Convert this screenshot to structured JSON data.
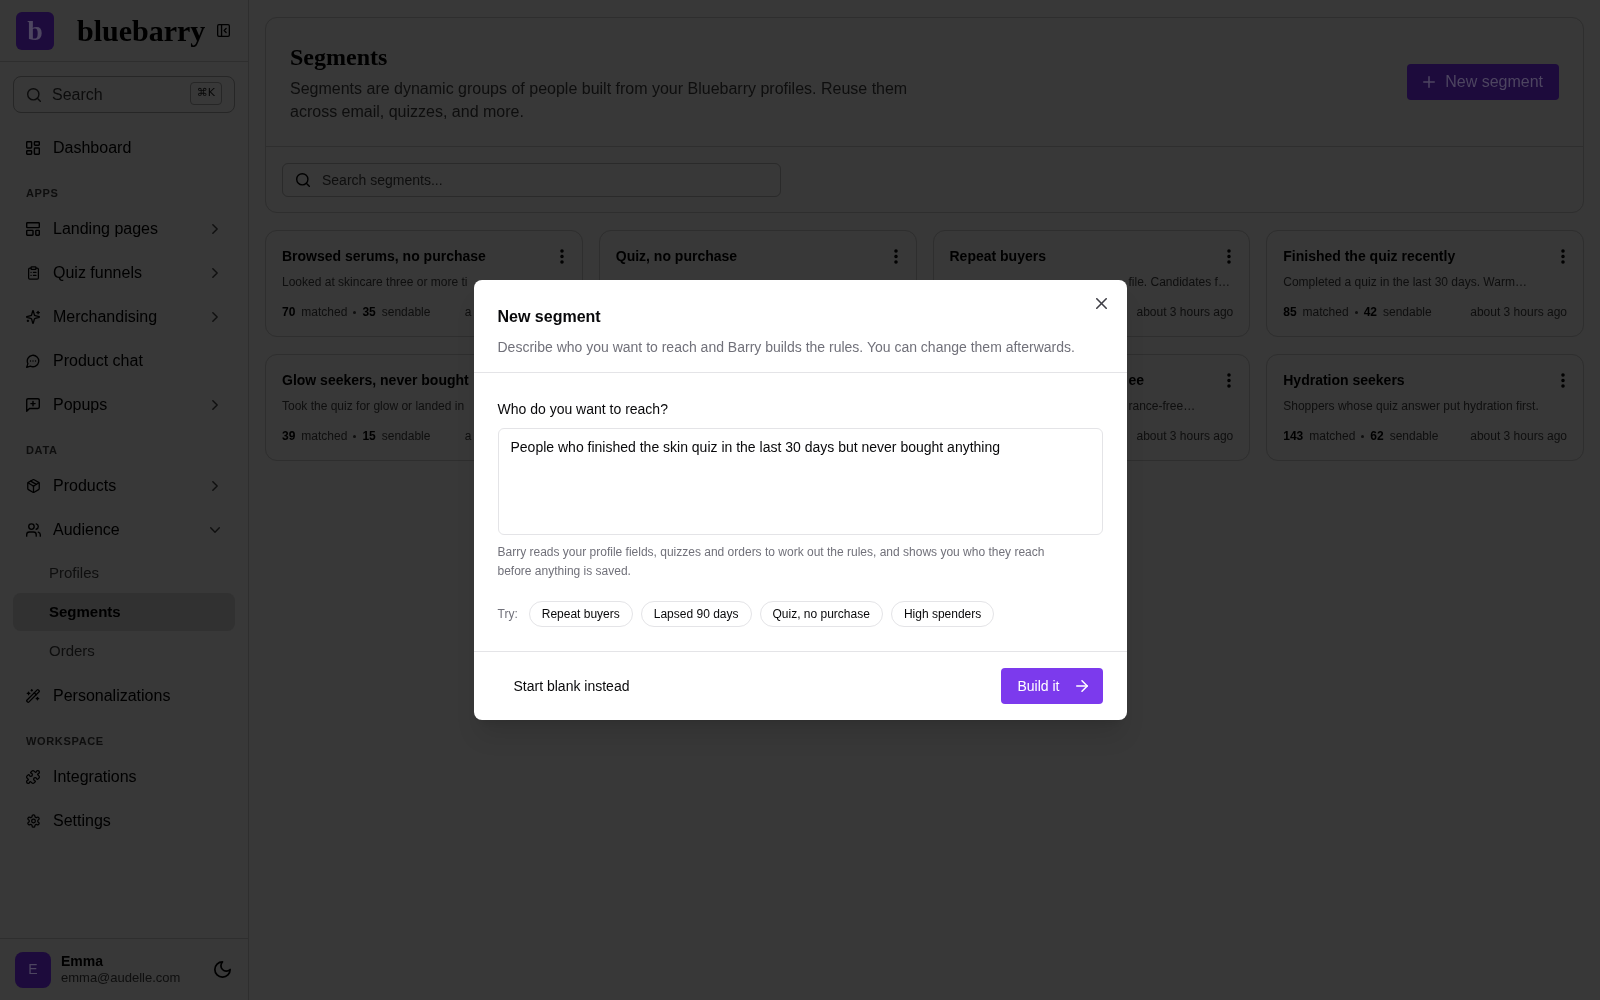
{
  "sidebar": {
    "logo": {
      "mark": "b",
      "name": "bluebarry"
    },
    "search": {
      "placeholder": "Search",
      "shortcut": "⌘K"
    },
    "sections": [
      {
        "items": [
          {
            "label": "Dashboard",
            "selected": false
          }
        ]
      },
      {
        "heading": "APPS",
        "items": [
          {
            "label": "Landing pages",
            "selected": false,
            "expanded": false
          },
          {
            "label": "Quiz funnels",
            "selected": false,
            "expanded": false
          },
          {
            "label": "Merchandising",
            "selected": false,
            "expanded": false
          },
          {
            "label": "Product chat",
            "selected": false
          },
          {
            "label": "Popups",
            "selected": false,
            "expanded": false
          }
        ]
      },
      {
        "heading": "DATA",
        "items": [
          {
            "label": "Products",
            "selected": false,
            "expanded": false
          },
          {
            "label": "Audience",
            "selected": false,
            "expanded": true,
            "children": [
              {
                "label": "Profiles",
                "selected": false
              },
              {
                "label": "Segments",
                "selected": true
              },
              {
                "label": "Orders",
                "selected": false
              }
            ]
          },
          {
            "label": "Personalizations",
            "selected": false
          }
        ]
      },
      {
        "heading": "WORKSPACE",
        "items": [
          {
            "label": "Integrations",
            "selected": false
          },
          {
            "label": "Settings",
            "selected": false
          }
        ]
      }
    ],
    "user": {
      "initial": "E",
      "name": "Emma",
      "email": "emma@audelle.com"
    }
  },
  "header": {
    "title": "Segments",
    "description": "Segments are dynamic groups of people built from your Bluebarry profiles. Reuse them across email, quizzes, and more.",
    "button": "New segment"
  },
  "search": {
    "placeholder": "Search segments..."
  },
  "cards": [
    {
      "kind": "body-cut-right",
      "title": "Browsed serums, no purchase",
      "description": "Looked at skincare three or more ti",
      "stats": [
        {
          "value": "70",
          "unit": "matched"
        },
        {
          "value": "35",
          "unit": "sendable"
        }
      ],
      "time": "a"
    },
    {
      "kind": "title-only",
      "title": "Quiz, no purchase"
    },
    {
      "kind": "body-cut-left",
      "title": "Repeat buyers",
      "description": "file. Candidates f…",
      "time": "about 3 hours ago"
    },
    {
      "kind": "whole",
      "title": "Finished the quiz recently",
      "description": "Completed a quiz in the last 30 days. Warm…",
      "stats": [
        {
          "value": "85",
          "unit": "matched"
        },
        {
          "value": "42",
          "unit": "sendable"
        }
      ],
      "time": "about 3 hours ago"
    },
    {
      "kind": "cut-right",
      "title": "Glow seekers, never bought",
      "description": "Took the quiz for glow or landed in",
      "stats": [
        {
          "value": "39",
          "unit": "matched"
        },
        {
          "value": "15",
          "unit": "sendable"
        }
      ],
      "time": "a"
    },
    {
      "kind": "cut-left",
      "title": "ee",
      "description": "rance-free…",
      "time": "about 3 hours ago"
    },
    {
      "kind": "whole",
      "title": "Hydration seekers",
      "description": "Shoppers whose quiz answer put hydration first.",
      "stats": [
        {
          "value": "143",
          "unit": "matched"
        },
        {
          "value": "62",
          "unit": "sendable"
        }
      ],
      "time": "about 3 hours ago"
    }
  ],
  "modal": {
    "title": "New segment",
    "description": "Describe who you want to reach and Barry builds the rules. You can change them afterwards.",
    "field": {
      "label": "Who do you want to reach?",
      "value": "People who finished the skin quiz in the last 30 days but never bought anything"
    },
    "help": "Barry reads your profile fields, quizzes and orders to work out the rules, and shows you who they reach before anything is saved.",
    "suggestions": {
      "label": "Try:",
      "chips": [
        "Repeat buyers",
        "Lapsed 90 days",
        "Quiz, no purchase",
        "High spenders"
      ]
    },
    "secondary_button": "Start blank instead",
    "primary_button": "Build it"
  }
}
